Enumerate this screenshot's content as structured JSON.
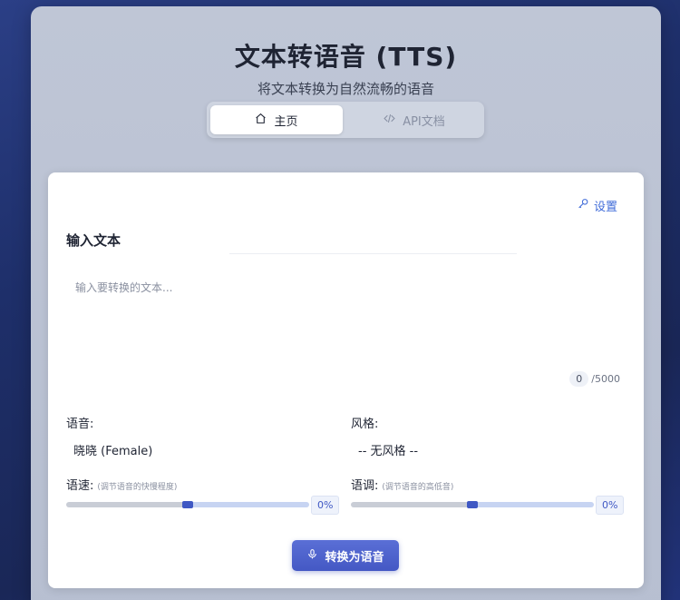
{
  "header": {
    "title": "文本转语音 (TTS)",
    "subtitle": "将文本转换为自然流畅的语音"
  },
  "tabs": [
    {
      "label": "主页",
      "icon": "home-icon",
      "active": true
    },
    {
      "label": "API文档",
      "icon": "code-icon",
      "active": false
    }
  ],
  "card": {
    "settings_label": "设置",
    "input_section_title": "输入文本",
    "input_placeholder": "输入要转换的文本...",
    "input_value": "",
    "char_count": "0",
    "char_limit": "/5000",
    "voice": {
      "label": "语音:",
      "value": "晓晓 (Female)"
    },
    "style": {
      "label": "风格:",
      "value": "-- 无风格 --"
    },
    "rate": {
      "label": "语速:",
      "hint": "(调节语音的快慢程度)",
      "value": "0%",
      "level": 0
    },
    "pitch": {
      "label": "语调:",
      "hint": "(调节语音的高低音)",
      "value": "0%",
      "level": 0
    },
    "convert_label": "转换为语音"
  },
  "colors": {
    "accent": "#4458c4",
    "link": "#3f6bd8"
  }
}
